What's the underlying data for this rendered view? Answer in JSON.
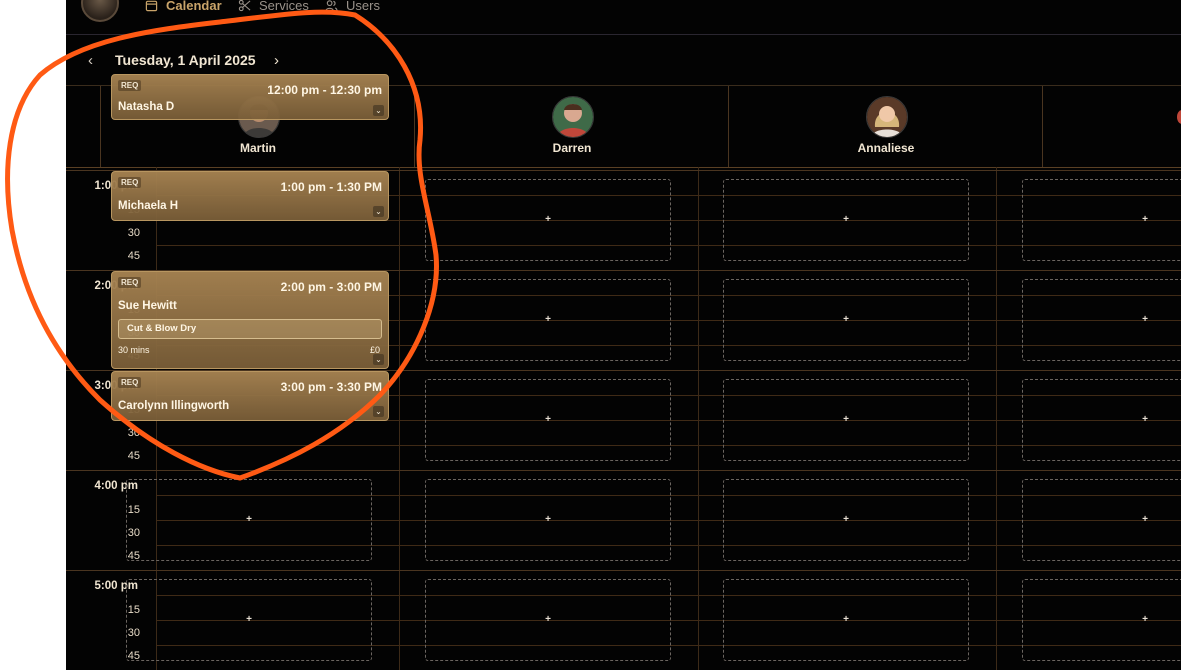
{
  "nav": {
    "calendar_label": "Calendar",
    "services_label": "Services",
    "users_label": "Users"
  },
  "date_bar": {
    "date": "Tuesday, 1 April 2025",
    "prev": "‹",
    "next": "›"
  },
  "staff": [
    {
      "name": "Martin"
    },
    {
      "name": "Darren"
    },
    {
      "name": "Annaliese"
    }
  ],
  "times": {
    "h1": "1:00 pm",
    "h2": "2:00 pm",
    "h3": "3:00 pm",
    "h4": "4:00 pm",
    "h5": "5:00 pm",
    "q15": "15",
    "q30": "30",
    "q45": "45"
  },
  "appointments": {
    "natasha": {
      "req": "REQ",
      "time": "12:00 pm - 12:30 pm",
      "client": "Natasha D"
    },
    "michaela": {
      "req": "REQ",
      "time": "1:00 pm - 1:30 PM",
      "client": "Michaela H"
    },
    "sue": {
      "req": "REQ",
      "time": "2:00 pm - 3:00 PM",
      "client": "Sue Hewitt",
      "service": "Cut & Blow Dry",
      "duration": "30 mins",
      "price": "£0"
    },
    "carolynn": {
      "req": "REQ",
      "time": "3:00 pm - 3:30 PM",
      "client": "Carolynn Illingworth"
    }
  },
  "slot_plus": "+",
  "colors": {
    "accent": "#c9a46a",
    "appointment": "#a88452",
    "annotation": "#ff5a14",
    "background": "#030303"
  }
}
